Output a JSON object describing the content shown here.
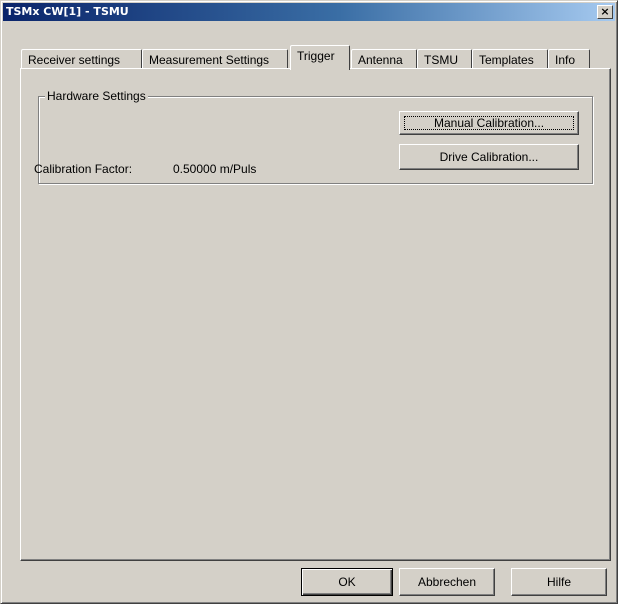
{
  "window": {
    "title": "TSMx CW[1] - TSMU",
    "close_glyph": "×"
  },
  "tabs": [
    {
      "label": "Receiver settings",
      "active": false
    },
    {
      "label": "Measurement Settings",
      "active": false
    },
    {
      "label": "Trigger",
      "active": true
    },
    {
      "label": "Antenna",
      "active": false
    },
    {
      "label": "TSMU",
      "active": false
    },
    {
      "label": "Templates",
      "active": false
    },
    {
      "label": "Info",
      "active": false
    }
  ],
  "hardware": {
    "group_title": "Hardware Settings",
    "manual_calibration_label": "Manual Calibration...",
    "drive_calibration_label": "Drive Calibration...",
    "calibration_factor_label": "Calibration Factor:",
    "calibration_factor_value": "0.50000 m/Puls"
  },
  "footer": {
    "ok_label": "OK",
    "cancel_label": "Abbrechen",
    "help_label": "Hilfe"
  },
  "colors": {
    "face": "#d4d0c8",
    "title_start": "#0a246a",
    "title_end": "#a6caf0"
  }
}
